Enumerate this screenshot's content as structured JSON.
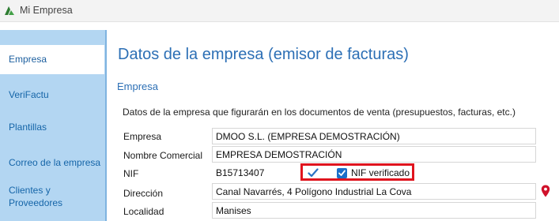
{
  "window": {
    "title": "Mi Empresa"
  },
  "sidebar": {
    "items": [
      {
        "label": "Empresa",
        "active": true
      },
      {
        "label": "VeriFactu",
        "active": false
      },
      {
        "label": "Plantillas",
        "active": false
      },
      {
        "label": "Correo de la empresa",
        "active": false
      },
      {
        "label": "Clientes y Proveedores",
        "active": false
      }
    ]
  },
  "main": {
    "page_title": "Datos de la empresa (emisor de facturas)",
    "section_title": "Empresa",
    "description": "Datos de la empresa que figurarán en los documentos de venta (presupuestos, facturas, etc.)",
    "fields": {
      "empresa": {
        "label": "Empresa",
        "value": "DMOO S.L. (EMPRESA DEMOSTRACIÓN)"
      },
      "nombre_comercial": {
        "label": "Nombre Comercial",
        "value": "EMPRESA DEMOSTRACIÓN"
      },
      "nif": {
        "label": "NIF",
        "value": "B15713407",
        "verified": true,
        "verified_label": "NIF verificado"
      },
      "direccion": {
        "label": "Dirección",
        "value": "Canal Navarrés, 4 Polígono Industrial La Cova"
      },
      "localidad": {
        "label": "Localidad",
        "value": "Manises"
      }
    }
  },
  "colors": {
    "accent": "#2c6fb5",
    "sidebar_bg": "#b3d6f2",
    "highlight_border": "#e0141e",
    "map_pin": "#d0112b"
  },
  "icons": {
    "app": "app-logo-icon",
    "check": "checkmark-icon",
    "location": "map-pin-icon"
  }
}
